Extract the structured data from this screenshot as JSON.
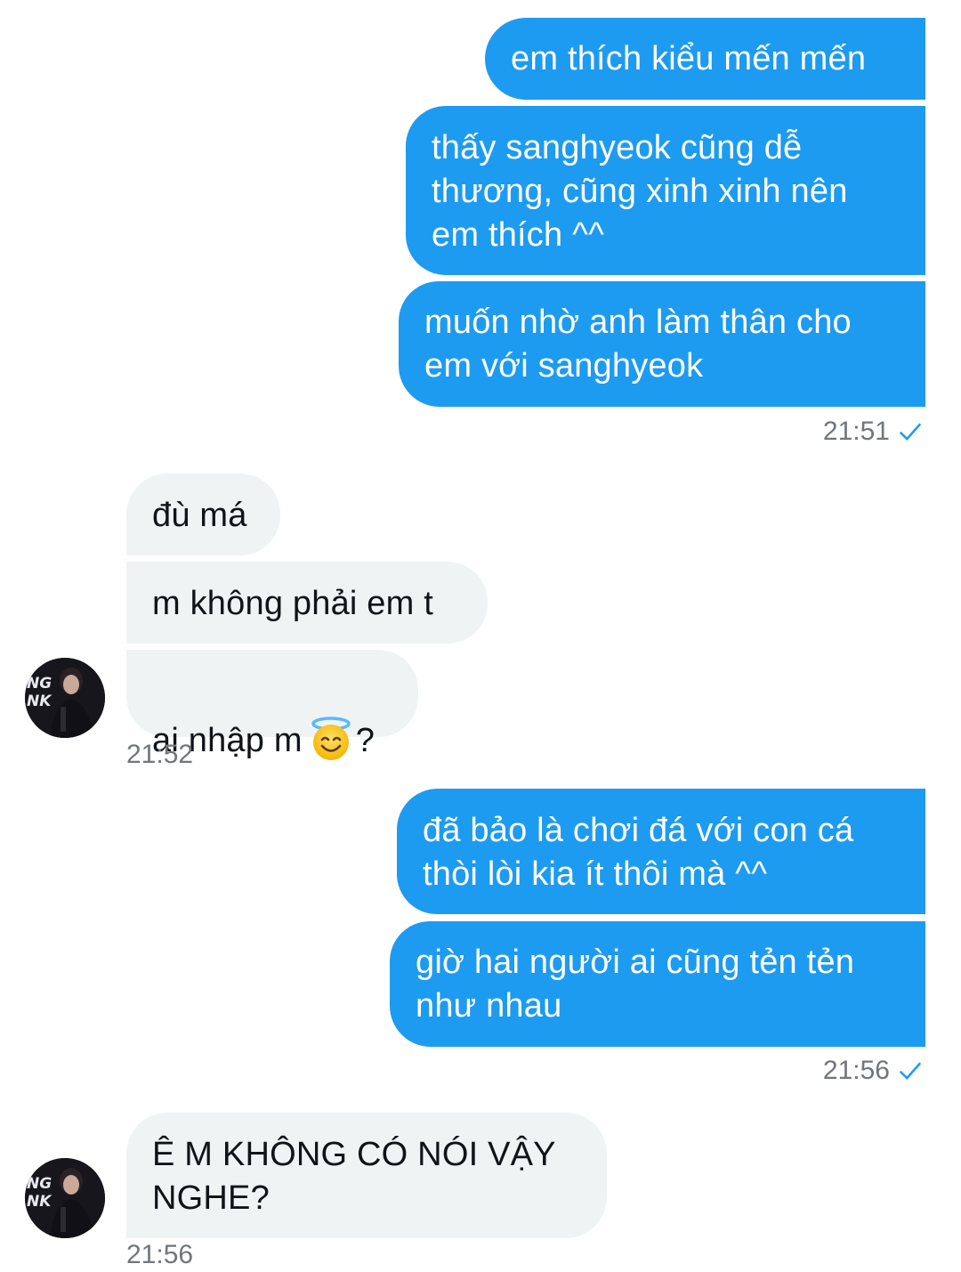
{
  "conversation": {
    "outgoing_group_1": {
      "messages": [
        "em thích kiểu mến mến",
        "thấy sanghyeok cũng dễ\nthương, cũng xinh xinh nên\nem thích ^^",
        "muốn nhờ anh làm thân cho\nem với sanghyeok"
      ],
      "timestamp": "21:51",
      "status_icon": "check-icon"
    },
    "incoming_group_1": {
      "messages": [
        "đù má",
        "m không phải em t",
        "ai nhập m"
      ],
      "emoji": "smiling-face-with-halo",
      "trailing_text": "?",
      "timestamp": "21:52",
      "avatar": "user-avatar"
    },
    "outgoing_group_2": {
      "messages": [
        "đã bảo là chơi đá với con cá\nthòi lòi kia ít thôi mà ^^",
        "giờ hai người ai cũng tẻn tẻn\nnhư nhau"
      ],
      "timestamp": "21:56",
      "status_icon": "check-icon"
    },
    "incoming_group_2": {
      "messages": [
        "Ê M KHÔNG CÓ NÓI VẬY\nNGHE?"
      ],
      "timestamp": "21:56",
      "avatar": "user-avatar"
    }
  },
  "colors": {
    "outgoing_bubble": "#1d9bf0",
    "incoming_bubble": "#eff3f4",
    "timestamp_text": "#71767b",
    "check_icon": "#1d9bf0"
  }
}
